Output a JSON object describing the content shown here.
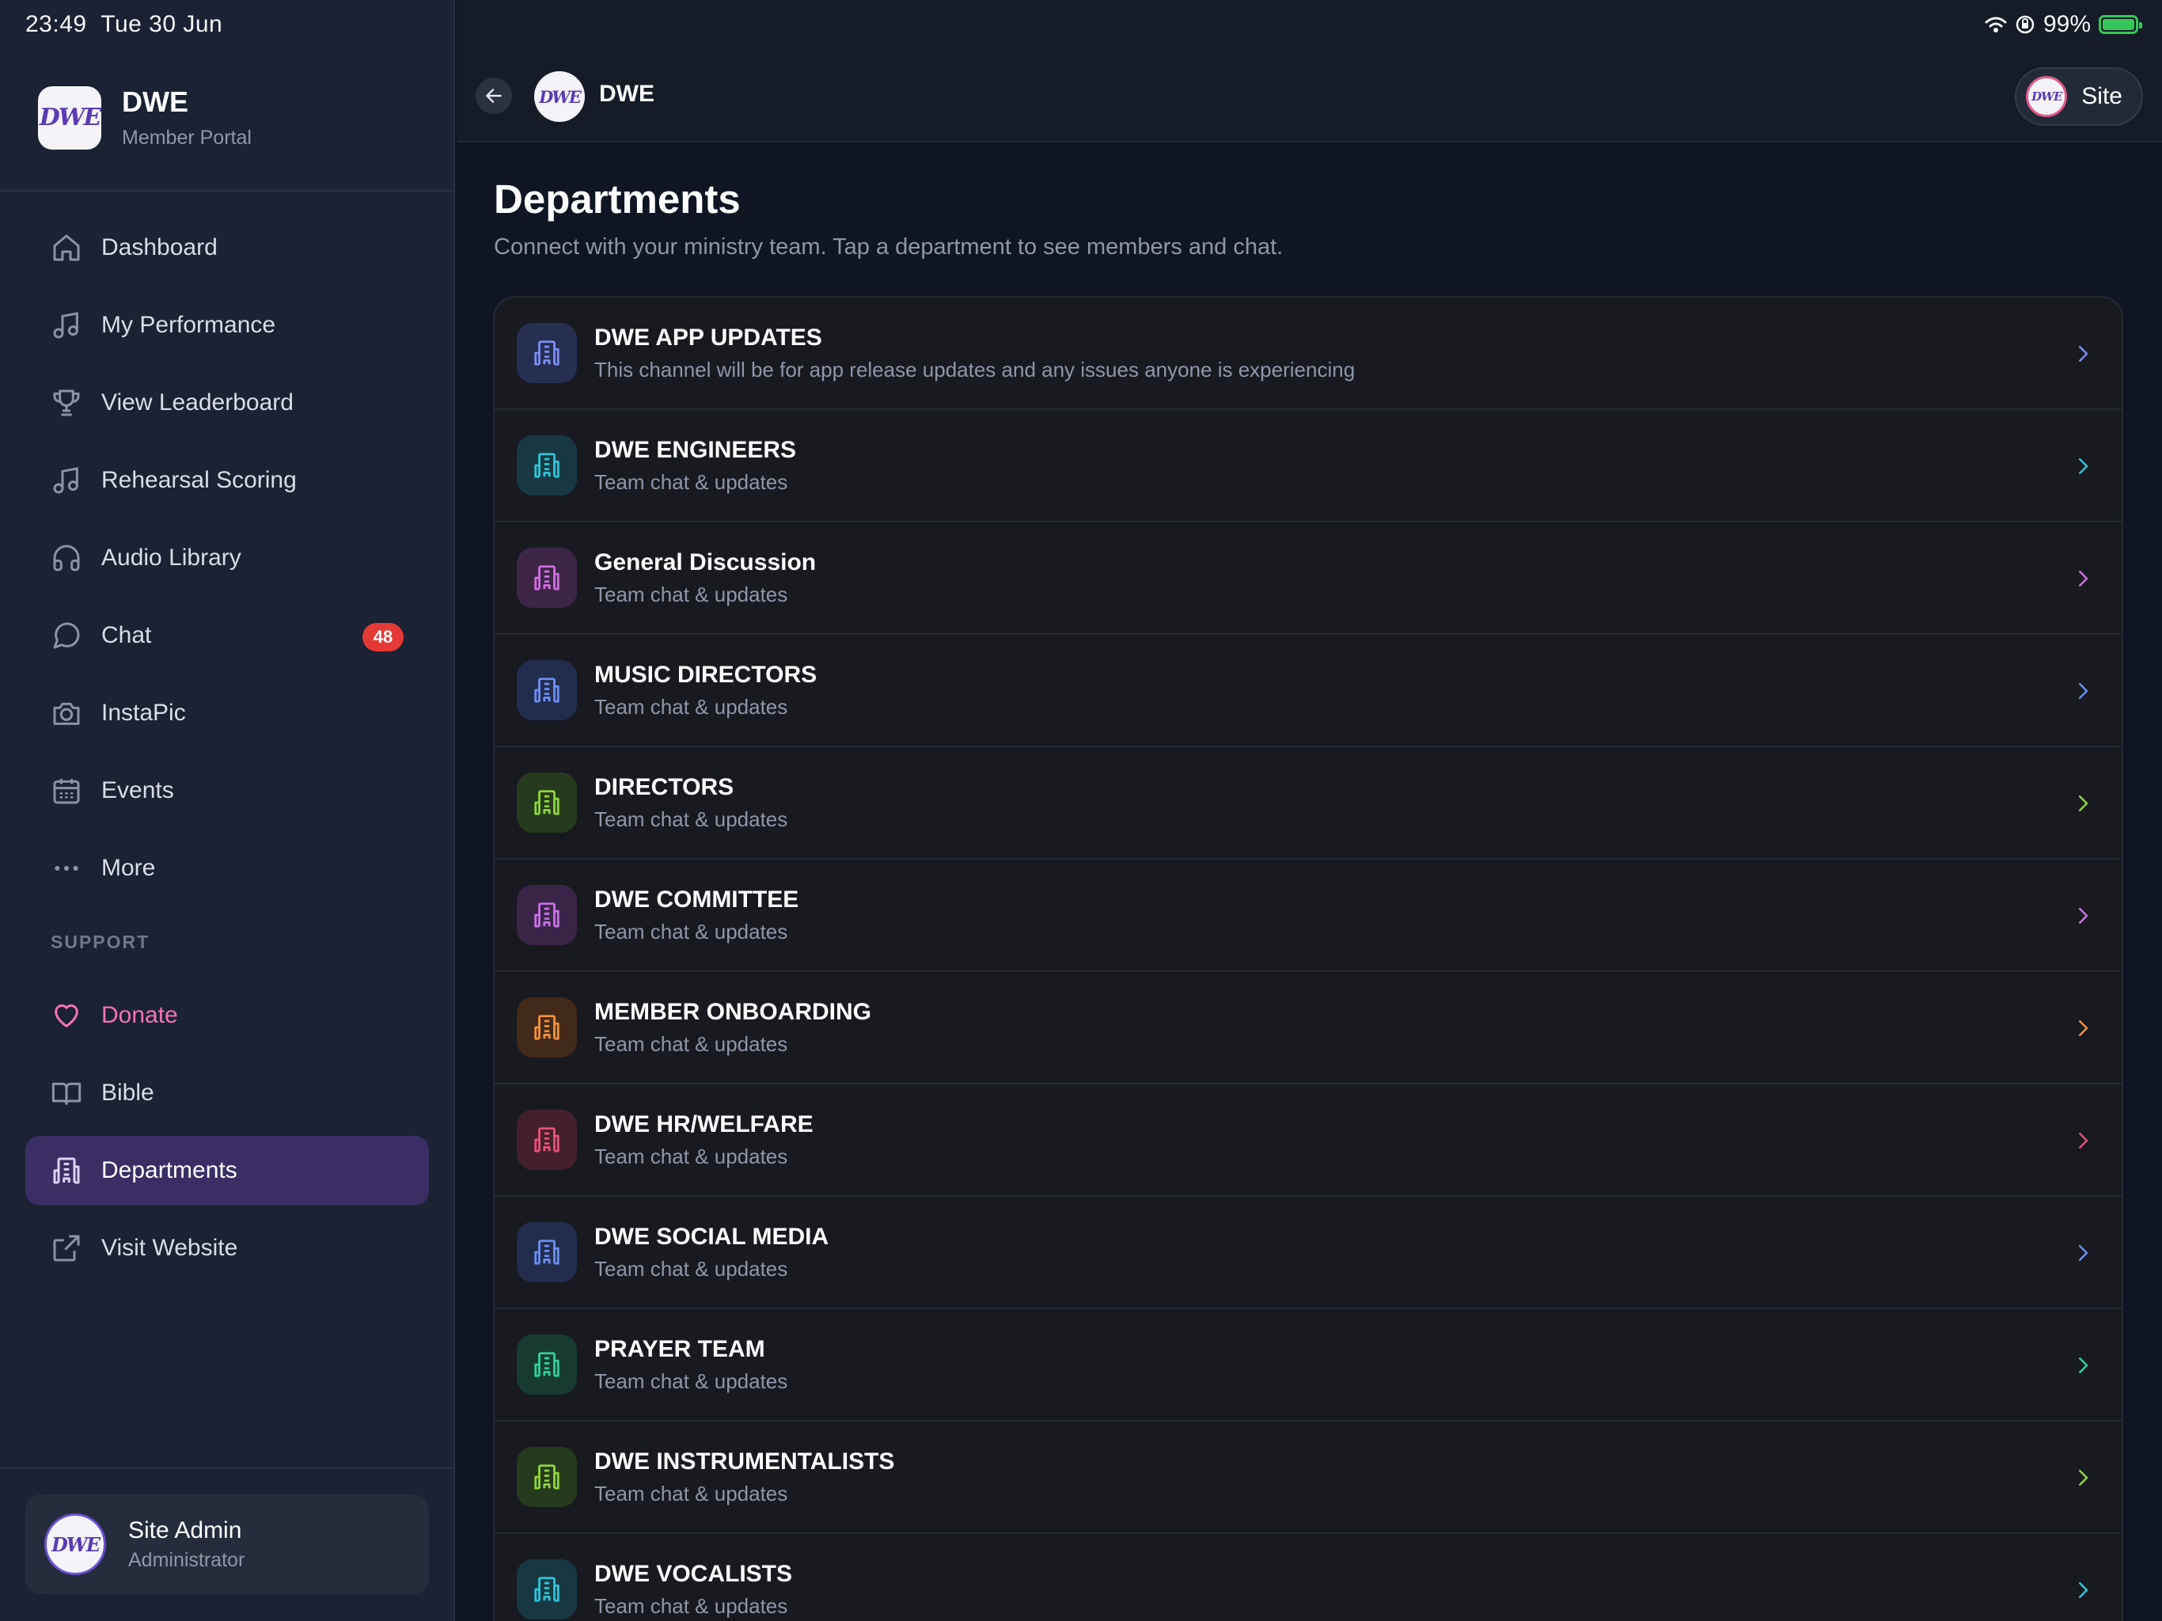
{
  "status_bar": {
    "time": "23:49",
    "date": "Tue 30 Jun",
    "battery": "99%"
  },
  "sidebar": {
    "brand_title": "DWE",
    "brand_subtitle": "Member Portal",
    "logo_text": "DWE",
    "items": [
      {
        "label": "Dashboard",
        "icon": "home-icon"
      },
      {
        "label": "My Performance",
        "icon": "music-note-icon"
      },
      {
        "label": "View Leaderboard",
        "icon": "trophy-icon"
      },
      {
        "label": "Rehearsal Scoring",
        "icon": "music-note-icon"
      },
      {
        "label": "Audio Library",
        "icon": "headphones-icon"
      },
      {
        "label": "Chat",
        "icon": "chat-bubble-icon",
        "badge": "48"
      },
      {
        "label": "InstaPic",
        "icon": "camera-icon"
      },
      {
        "label": "Events",
        "icon": "calendar-icon"
      },
      {
        "label": "More",
        "icon": "more-dots-icon"
      }
    ],
    "support_label": "SUPPORT",
    "support_items": [
      {
        "label": "Donate",
        "icon": "heart-icon"
      },
      {
        "label": "Bible",
        "icon": "book-icon"
      },
      {
        "label": "Departments",
        "icon": "building-icon",
        "active": true
      },
      {
        "label": "Visit Website",
        "icon": "external-link-icon"
      }
    ],
    "user": {
      "name": "Site Admin",
      "role": "Administrator"
    }
  },
  "topbar": {
    "title": "DWE",
    "site_label": "Site"
  },
  "main": {
    "title": "Departments",
    "subtitle": "Connect with your ministry team. Tap a department to see members and chat.",
    "departments": [
      {
        "name": "DWE APP UPDATES",
        "desc": "This channel will be for app release updates and any issues anyone is experiencing",
        "color": "#7b8cf0",
        "bg": "#262e52"
      },
      {
        "name": "DWE ENGINEERS",
        "desc": "Team chat & updates",
        "color": "#2ec4d6",
        "bg": "#173843"
      },
      {
        "name": "General Discussion",
        "desc": "Team chat & updates",
        "color": "#d06ee0",
        "bg": "#3c2546"
      },
      {
        "name": "MUSIC DIRECTORS",
        "desc": "Team chat & updates",
        "color": "#6b8ff0",
        "bg": "#222d4e"
      },
      {
        "name": "DIRECTORS",
        "desc": "Team chat & updates",
        "color": "#8fd43c",
        "bg": "#263a1d"
      },
      {
        "name": "DWE COMMITTEE",
        "desc": "Team chat & updates",
        "color": "#c872e6",
        "bg": "#3a2549"
      },
      {
        "name": "MEMBER ONBOARDING",
        "desc": "Team chat & updates",
        "color": "#f0923a",
        "bg": "#43291a"
      },
      {
        "name": "DWE HR/WELFARE",
        "desc": "Team chat & updates",
        "color": "#e8507a",
        "bg": "#43202c"
      },
      {
        "name": "DWE SOCIAL MEDIA",
        "desc": "Team chat & updates",
        "color": "#6b8ff0",
        "bg": "#222d4e"
      },
      {
        "name": "PRAYER TEAM",
        "desc": "Team chat & updates",
        "color": "#2ed09a",
        "bg": "#173b31"
      },
      {
        "name": "DWE INSTRUMENTALISTS",
        "desc": "Team chat & updates",
        "color": "#8fd43c",
        "bg": "#263a1d"
      },
      {
        "name": "DWE VOCALISTS",
        "desc": "Team chat & updates",
        "color": "#2ec4d6",
        "bg": "#173843"
      }
    ]
  }
}
